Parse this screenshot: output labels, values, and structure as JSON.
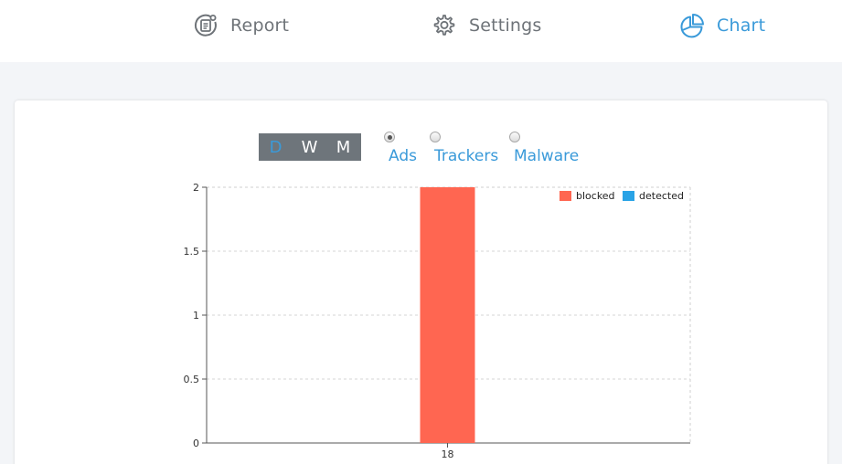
{
  "nav": {
    "items": [
      {
        "label": "Report",
        "icon": "report-icon",
        "active": false
      },
      {
        "label": "Settings",
        "icon": "gear-icon",
        "active": false
      },
      {
        "label": "Chart",
        "icon": "pie-chart-icon",
        "active": true
      }
    ]
  },
  "period": {
    "options": [
      "D",
      "W",
      "M"
    ],
    "selected": "D"
  },
  "filter": {
    "options": [
      {
        "label": "Ads",
        "checked": true
      },
      {
        "label": "Trackers",
        "checked": false
      },
      {
        "label": "Malware",
        "checked": false
      }
    ]
  },
  "colors": {
    "accent": "#3a9ad9",
    "blocked": "#ff6651",
    "detected": "#29a3e6",
    "toggle_bg": "#6e757b"
  },
  "chart_data": {
    "type": "bar",
    "categories": [
      "18"
    ],
    "series": [
      {
        "name": "blocked",
        "values": [
          2
        ]
      },
      {
        "name": "detected",
        "values": [
          0
        ]
      }
    ],
    "yticks": [
      "0",
      "0.5",
      "1",
      "1.5",
      "2"
    ],
    "ylim": [
      0,
      2
    ],
    "grid": true,
    "legend": "top-right"
  }
}
